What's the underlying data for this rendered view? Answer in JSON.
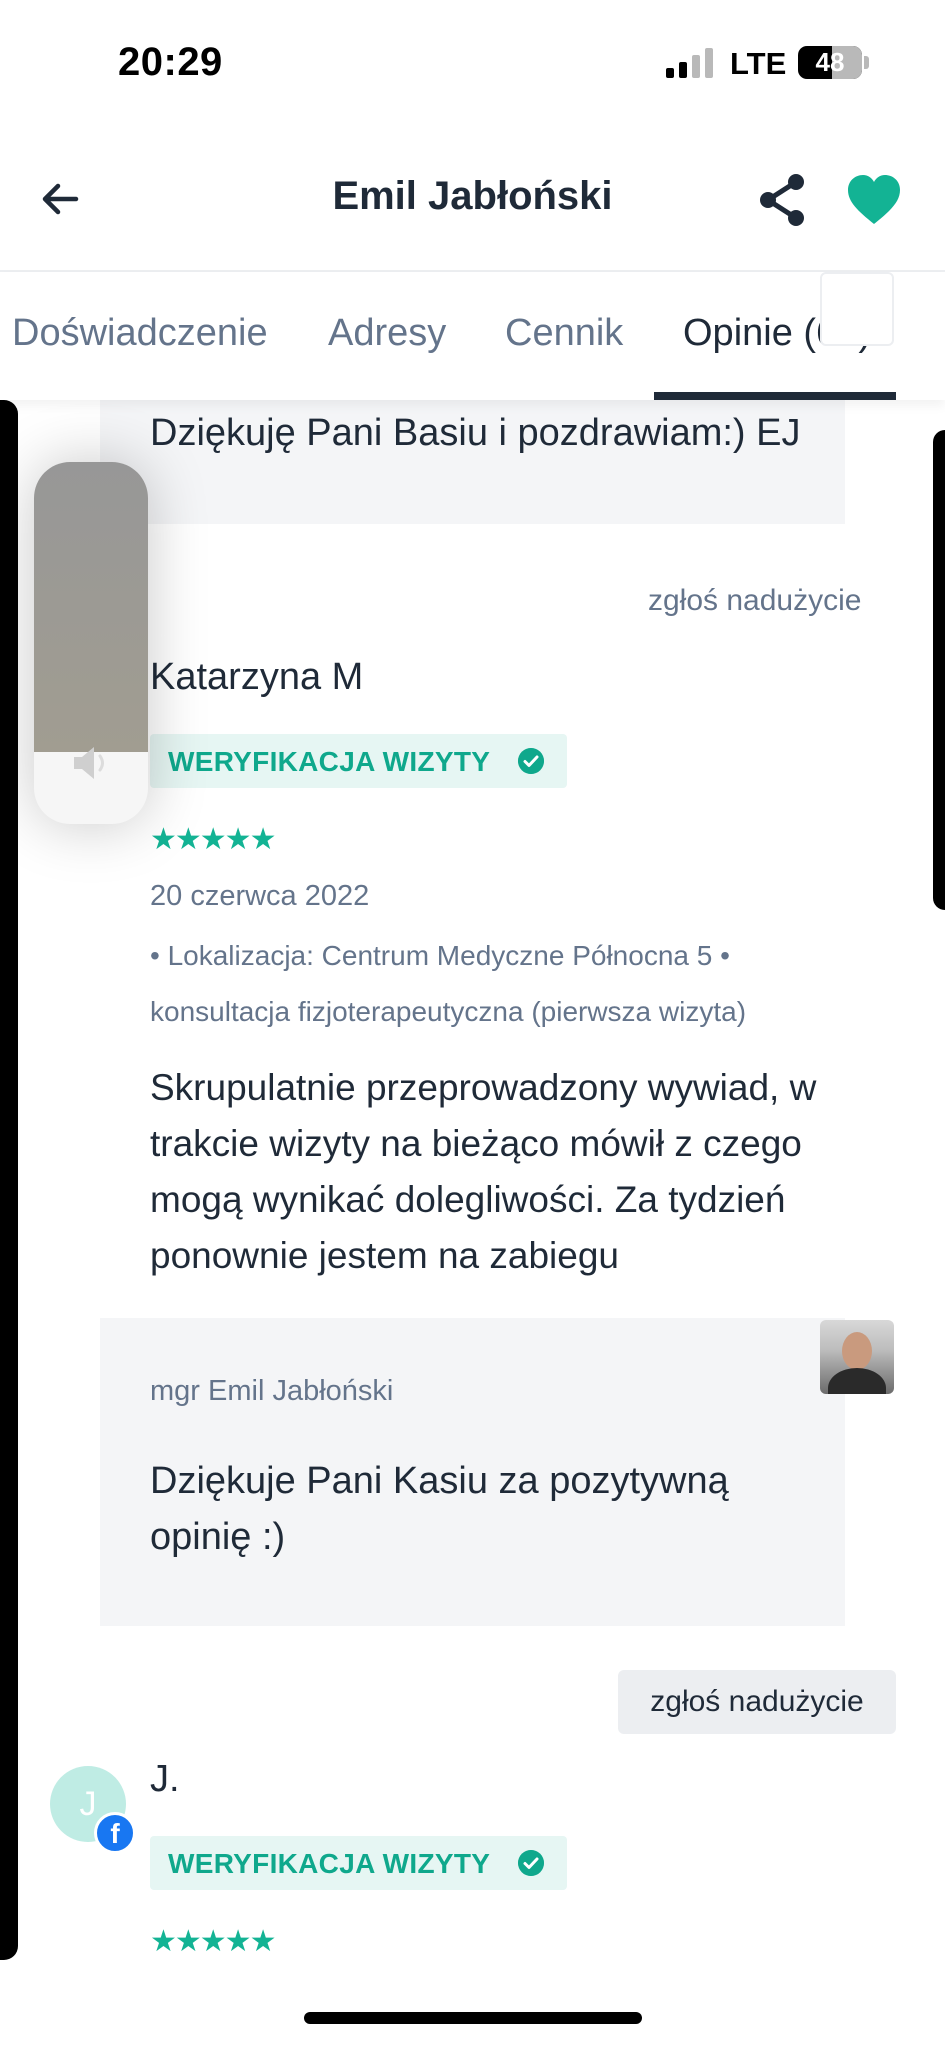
{
  "status_bar": {
    "time": "20:29",
    "network": "LTE",
    "battery": "48"
  },
  "header": {
    "title": "Emil Jabłoński",
    "back_icon": "arrow-left-icon",
    "share_icon": "share-icon",
    "favorite_icon": "heart-icon",
    "accent": "#13b394"
  },
  "tabs": [
    {
      "label": "Doświadczenie",
      "active": false
    },
    {
      "label": "Adresy",
      "active": false
    },
    {
      "label": "Cennik",
      "active": false
    },
    {
      "label": "Opinie (60)",
      "active": true
    }
  ],
  "previous_reply": {
    "text": "Dziękuję Pani Basiu i pozdrawiam:) EJ"
  },
  "reviews": [
    {
      "report_label": "zgłoś nadużycie",
      "author": "Katarzyna M",
      "badge": "WERYFIKACJA WIZYTY",
      "rating": 5,
      "stars": "★★★★★",
      "date": "20 czerwca 2022",
      "meta": "• Lokalizacja: Centrum Medyczne Północna 5 • konsultacja fizjoterapeutyczna (pierwsza wizyta)",
      "body": "Skrupulatnie przeprowadzony wywiad, w trakcie wizyty na bieżąco mówił z czego mogą wynikać dolegliwości. Za tydzień ponownie jestem na zabiegu",
      "reply": {
        "author": "mgr Emil Jabłoński",
        "text": "Dziękuje Pani Kasiu za pozytywną opinię :)"
      }
    },
    {
      "report_label": "zgłoś nadużycie",
      "author": "J.",
      "avatar_letter": "J",
      "badge": "WERYFIKACJA WIZYTY",
      "rating": 5,
      "stars": "★★★★★"
    }
  ],
  "volume": {
    "level": 0.82,
    "icon": "speaker-icon"
  },
  "colors": {
    "text": "#1f2a38",
    "muted": "#64748b",
    "badge_bg": "#e6f6f3",
    "badge_text": "#0fa88c",
    "reply_bg": "#f4f5f7"
  }
}
